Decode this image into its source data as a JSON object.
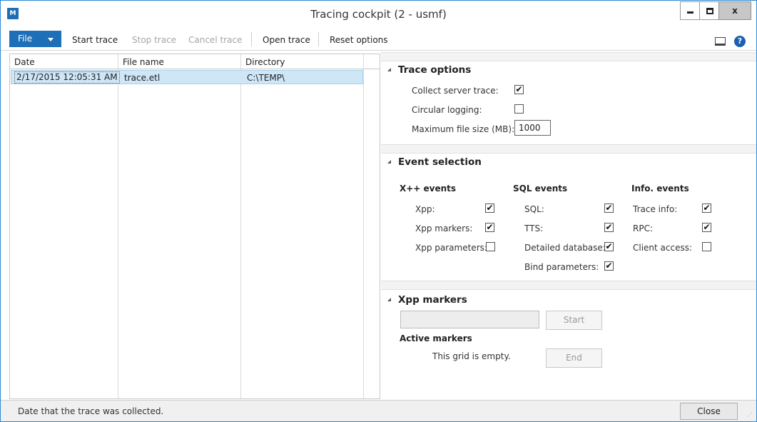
{
  "window": {
    "title": "Tracing cockpit (2 - usmf)",
    "app_icon_text": "M",
    "close_glyph": "x"
  },
  "toolbar": {
    "file_label": "File",
    "start_trace": "Start trace",
    "stop_trace": "Stop trace",
    "cancel_trace": "Cancel trace",
    "open_trace": "Open trace",
    "reset_options": "Reset options",
    "help_glyph": "?"
  },
  "grid": {
    "columns": [
      "Date",
      "File name",
      "Directory"
    ],
    "rows": [
      {
        "date": "2/17/2015 12:05:31 AM",
        "file_name": "trace.etl",
        "directory": "C:\\TEMP\\"
      }
    ]
  },
  "trace_options": {
    "title": "Trace options",
    "collect_server_trace_label": "Collect server trace:",
    "collect_server_trace_checked": true,
    "circular_logging_label": "Circular logging:",
    "circular_logging_checked": false,
    "max_file_size_label": "Maximum file size (MB):",
    "max_file_size_value": "1000"
  },
  "event_selection": {
    "title": "Event selection",
    "groups": [
      {
        "heading": "X++ events",
        "items": [
          {
            "label": "Xpp:",
            "checked": true
          },
          {
            "label": "Xpp markers:",
            "checked": true
          },
          {
            "label": "Xpp parameters:",
            "checked": false
          }
        ]
      },
      {
        "heading": "SQL events",
        "items": [
          {
            "label": "SQL:",
            "checked": true
          },
          {
            "label": "TTS:",
            "checked": true
          },
          {
            "label": "Detailed database:",
            "checked": true
          },
          {
            "label": "Bind parameters:",
            "checked": true
          }
        ]
      },
      {
        "heading": "Info. events",
        "items": [
          {
            "label": "Trace info:",
            "checked": true
          },
          {
            "label": "RPC:",
            "checked": true
          },
          {
            "label": "Client access:",
            "checked": false
          }
        ]
      }
    ]
  },
  "xpp_markers": {
    "title": "Xpp markers",
    "marker_input_value": "",
    "start_button": "Start",
    "active_markers_label": "Active markers",
    "empty_text": "This grid is empty.",
    "end_button": "End"
  },
  "statusbar": {
    "text": "Date that the trace was collected.",
    "close_button": "Close"
  }
}
